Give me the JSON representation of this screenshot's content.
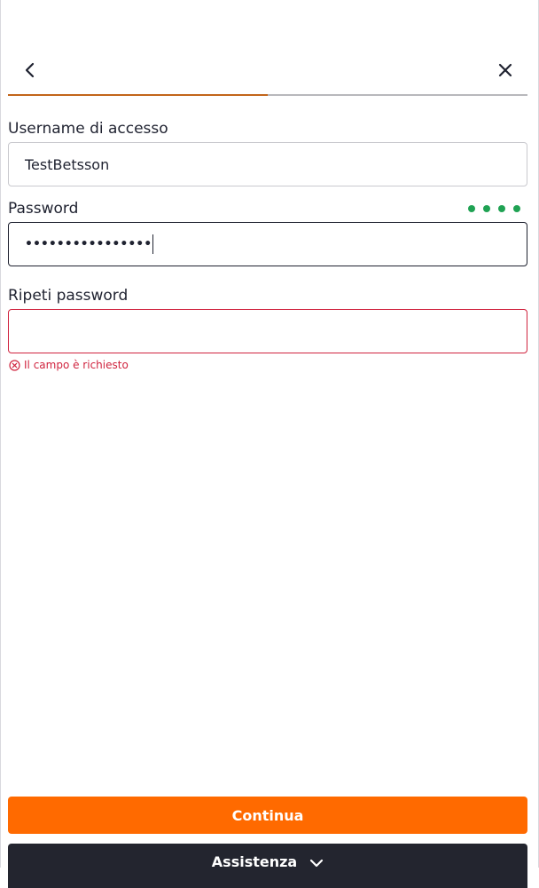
{
  "header": {
    "back_icon": "chevron-left-icon",
    "close_icon": "close-icon"
  },
  "progress": {
    "fraction": 0.5,
    "fill_color": "#c2651a"
  },
  "form": {
    "username": {
      "label": "Username di accesso",
      "value": "TestBetsson"
    },
    "password": {
      "label": "Password",
      "value": "••••••••••••••••",
      "strength_level": 4,
      "strength_color": "#1fa253"
    },
    "repeat_password": {
      "label": "Ripeti password",
      "value": "",
      "error": "Il campo è richiesto",
      "error_color": "#d0243f"
    }
  },
  "buttons": {
    "continue_label": "Continua",
    "continue_color": "#ff6a00",
    "assist_label": "Assistenza",
    "assist_icon": "chevron-down-icon"
  }
}
